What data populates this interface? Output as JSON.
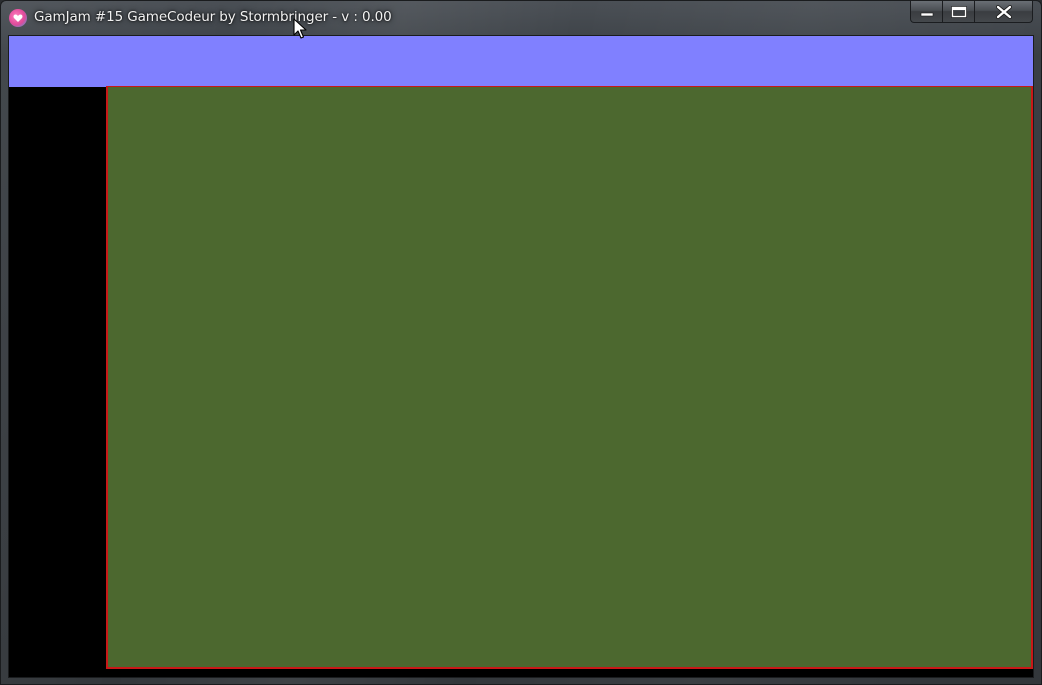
{
  "window": {
    "title": "GamJam #15 GameCodeur by Stormbringer - v : 0.00",
    "app_icon": "heart-icon"
  },
  "caption_buttons": {
    "minimize_icon": "minimize-icon",
    "maximize_icon": "maximize-icon",
    "close_icon": "close-icon"
  },
  "game": {
    "sky_color": "#8080ff",
    "side_panel_color": "#000000",
    "field_color": "#4c682f",
    "field_border_color": "#c81818"
  }
}
